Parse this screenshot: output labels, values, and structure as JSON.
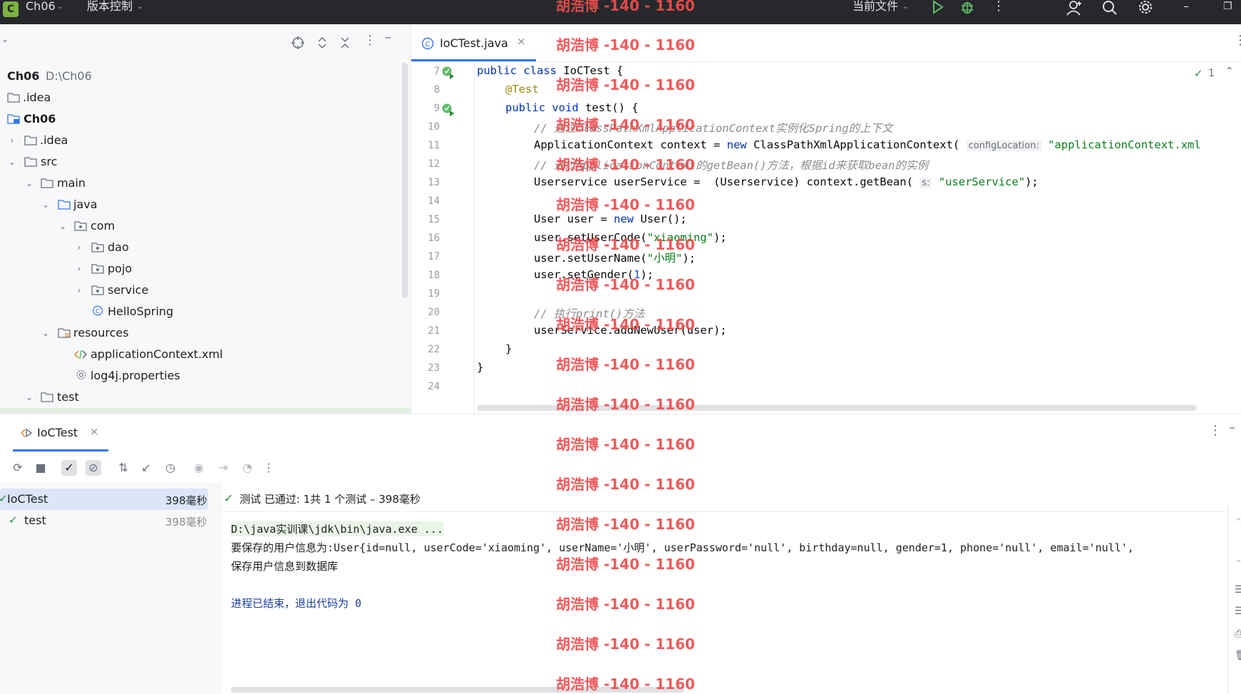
{
  "titlebar": {
    "project_badge": "C",
    "project_name": "Ch06",
    "vcs_menu": "版本控制",
    "run_config": "当前文件",
    "icons": [
      "chevron-down-icon",
      "run-icon",
      "debug-icon",
      "more-vertical-icon",
      "add-user-icon",
      "search-icon",
      "settings-icon",
      "minimize-icon",
      "restore-icon"
    ]
  },
  "watermark": "胡浩博 -140 - 1160",
  "project": {
    "root": {
      "name": "Ch06",
      "path": "D:\\Ch06"
    },
    "items": [
      {
        "label": ".idea"
      },
      {
        "label": "Ch06"
      },
      {
        "label": ".idea"
      },
      {
        "label": "src"
      },
      {
        "label": "main"
      },
      {
        "label": "java"
      },
      {
        "label": "com"
      },
      {
        "label": "dao"
      },
      {
        "label": "pojo"
      },
      {
        "label": "service"
      },
      {
        "label": "HelloSpring"
      },
      {
        "label": "resources"
      },
      {
        "label": "applicationContext.xml"
      },
      {
        "label": "log4j.properties"
      },
      {
        "label": "test"
      }
    ]
  },
  "editor": {
    "tab_label": "IoCTest.java",
    "inspection_count": "1",
    "line_numbers": [
      "7",
      "8",
      "9",
      "10",
      "11",
      "12",
      "13",
      "14",
      "15",
      "16",
      "17",
      "18",
      "19",
      "20",
      "21",
      "22",
      "23",
      "24"
    ],
    "hints": {
      "config_location": "configLocation:",
      "s": "s:"
    },
    "code": {
      "l7_a": "public class ",
      "l7_b": "IoCTest {",
      "l8": "@Test",
      "l9_a": "public void ",
      "l9_b": "test() {",
      "l10": "// 通过ClassPathXmlApplicationContext实例化Spring的上下文",
      "l11_a": "ApplicationContext context = ",
      "l11_kw": "new",
      "l11_b": " ClassPathXmlApplicationContext( ",
      "l11_str": "\"applicationContext.xml",
      "l12": "// 通过ApplicationContext的getBean()方法，根据id来获取bean的实例",
      "l13_a": "Userservice userService =  (Userservice) context.getBean( ",
      "l13_str": "\"userService\"",
      "l13_b": ");",
      "l15_a": "User user = ",
      "l15_kw": "new",
      "l15_b": " User();",
      "l16_a": "user.setUserCode(",
      "l16_str": "\"xiaoming\"",
      "l16_b": ");",
      "l17_a": "user.setUserName(",
      "l17_str": "\"小明\"",
      "l17_b": ");",
      "l18_a": "user.setGender(",
      "l18_num": "1",
      "l18_b": ");",
      "l20": "// 执行print()方法",
      "l21": "userService.addNewUser(user);",
      "l22": "}",
      "l23": "}"
    }
  },
  "run": {
    "tab_label": "IoCTest",
    "status": "测试 已通过: 1共 1 个测试 – 398毫秒",
    "tests": [
      {
        "name": "IoCTest",
        "time": "398毫秒"
      },
      {
        "name": "test",
        "time": "398毫秒"
      }
    ],
    "console": [
      "D:\\java实训课\\jdk\\bin\\java.exe ...",
      "要保存的用户信息为:User{id=null, userCode='xiaoming', userName='小明', userPassword='null', birthday=null, gender=1, phone='null', email='null',",
      "保存用户信息到数据库",
      "",
      "进程已结束，退出代码为 0"
    ]
  },
  "colors": {
    "accent": "#3574f0",
    "pass": "#208a3c",
    "watermark": "#ef4d4d",
    "titlebar": "#27282c"
  }
}
